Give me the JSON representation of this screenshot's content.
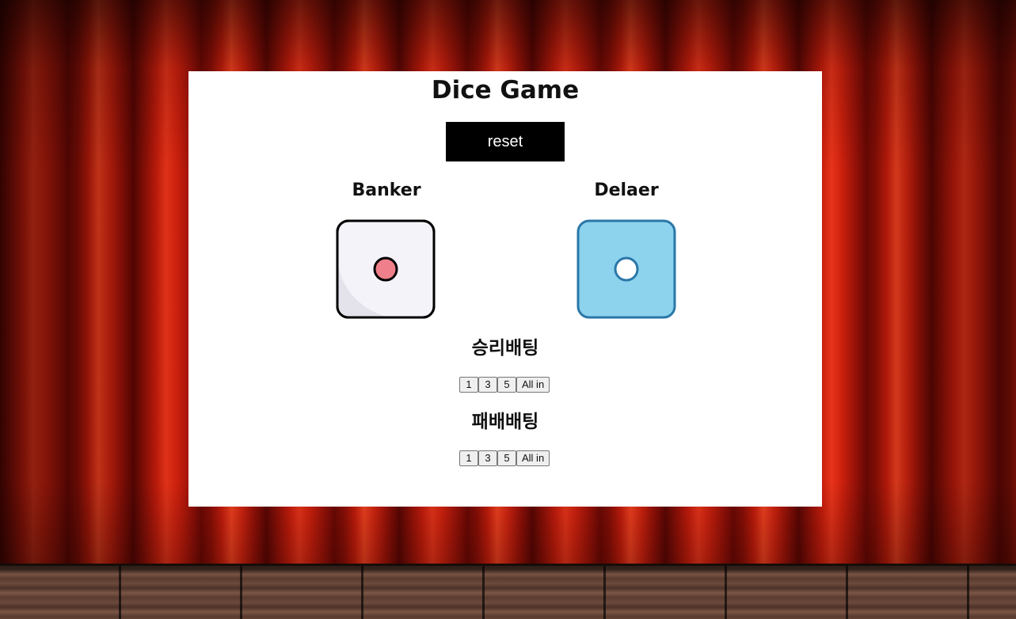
{
  "game": {
    "title": "Dice Game",
    "reset_label": "reset"
  },
  "players": {
    "banker": {
      "label": "Banker",
      "die_face": 1
    },
    "dealer": {
      "label": "Delaer",
      "die_face": 1
    }
  },
  "betting": {
    "win": {
      "title": "승리배팅",
      "options": [
        "1",
        "3",
        "5",
        "All in"
      ]
    },
    "lose": {
      "title": "패배배팅",
      "options": [
        "1",
        "3",
        "5",
        "All in"
      ]
    }
  },
  "colors": {
    "banker_die_fill": "#f5f3fa",
    "banker_pip": "#ef7f8a",
    "dealer_die_fill": "#8dd3ee",
    "dealer_die_stroke": "#2a77a8",
    "reset_bg": "#000000"
  }
}
